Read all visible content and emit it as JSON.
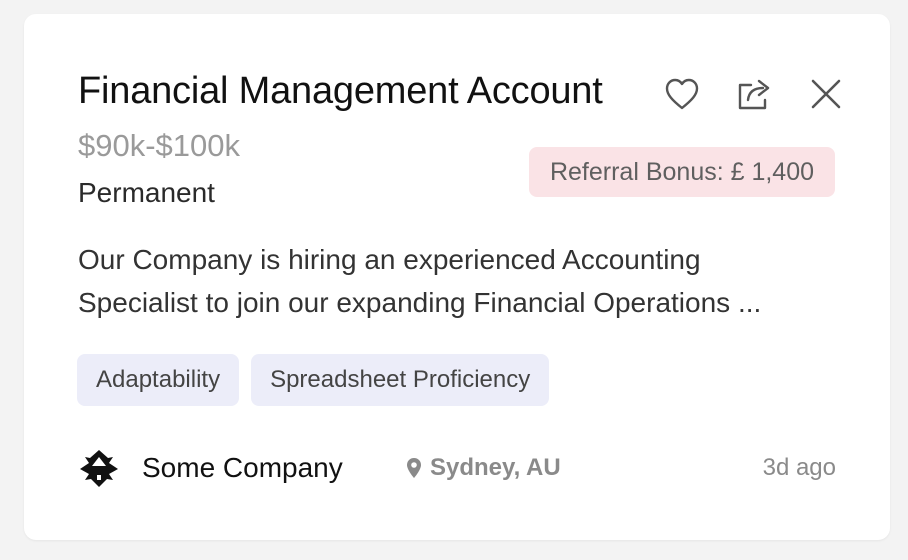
{
  "job": {
    "title": "Financial Management Account",
    "salary": "$90k-$100k",
    "type": "Permanent",
    "referral_bonus": "Referral Bonus: £ 1,400",
    "description": "Our Company is hiring an experienced Accounting Specialist to join our expanding Financial Operations ...",
    "tags": [
      "Adaptability",
      "Spreadsheet Proficiency"
    ],
    "company": "Some Company",
    "location": "Sydney, AU",
    "posted": "3d ago"
  },
  "actions": {
    "favorite_icon": "heart-icon",
    "share_icon": "share-icon",
    "close_icon": "close-icon"
  },
  "colors": {
    "referral_bg": "#fae3e6",
    "tag_bg": "#ecedf9",
    "muted_text": "#8a8a8a"
  }
}
